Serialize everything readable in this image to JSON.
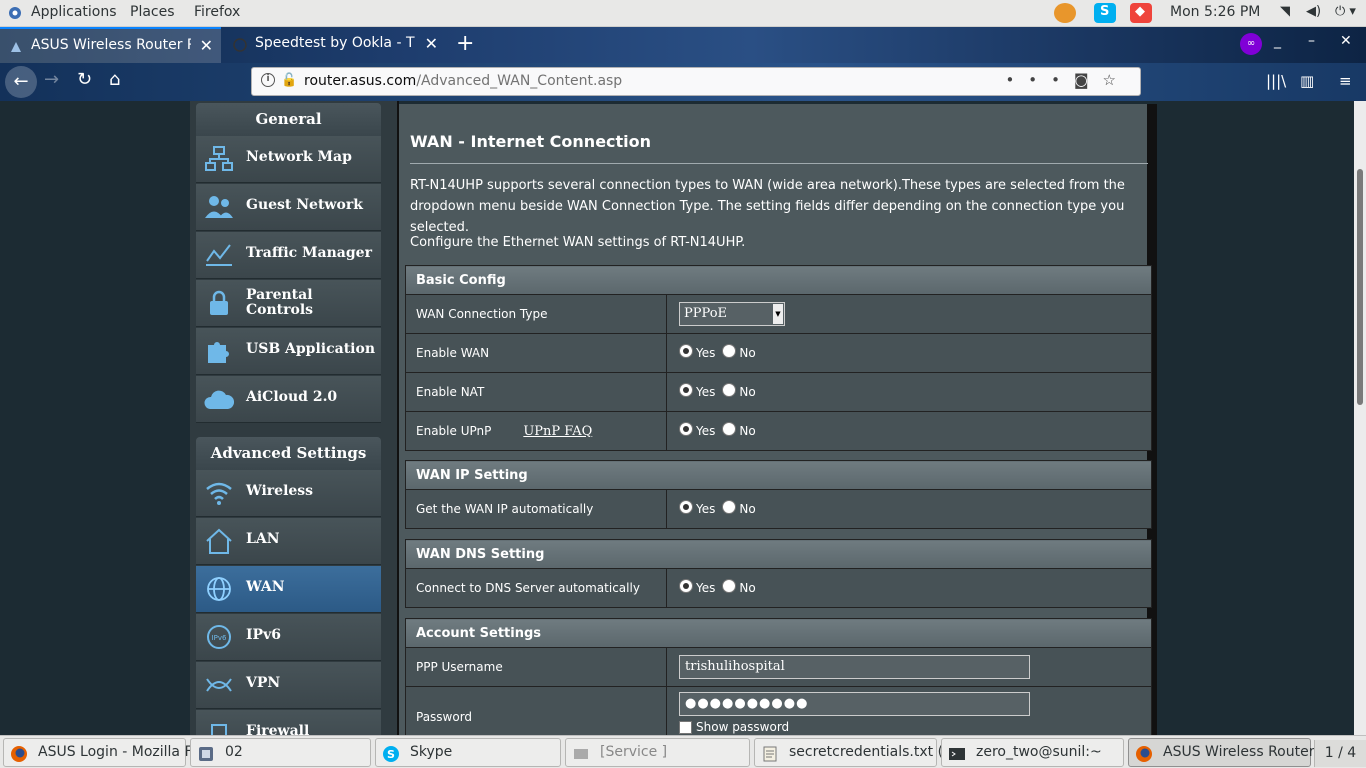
{
  "topbar": {
    "applications": "Applications",
    "places": "Places",
    "firefox": "Firefox",
    "clock": "Mon  5:26 PM",
    "tray_icons": [
      "hexchat-icon",
      "skype-icon",
      "anydesk-icon"
    ]
  },
  "browser": {
    "tabs": [
      {
        "title": "ASUS Wireless Router RT",
        "active": true
      },
      {
        "title": "Speedtest by Ookla - The",
        "active": false
      }
    ],
    "new_tab": "+",
    "url_host": "router.asus.com",
    "url_path": "/Advanced_WAN_Content.asp",
    "url_more": "•••"
  },
  "sidebar": {
    "general_heading": "General",
    "general_items": [
      {
        "label": "Network Map",
        "icon": "network-map-icon"
      },
      {
        "label": "Guest Network",
        "icon": "guest-network-icon"
      },
      {
        "label": "Traffic Manager",
        "icon": "traffic-manager-icon"
      },
      {
        "label": "Parental Controls",
        "icon": "lock-icon"
      },
      {
        "label": "USB Application",
        "icon": "puzzle-icon"
      },
      {
        "label": "AiCloud 2.0",
        "icon": "cloud-icon"
      }
    ],
    "advanced_heading": "Advanced Settings",
    "advanced_items": [
      {
        "label": "Wireless",
        "icon": "wifi-icon"
      },
      {
        "label": "LAN",
        "icon": "house-icon"
      },
      {
        "label": "WAN",
        "icon": "globe-icon",
        "selected": true
      },
      {
        "label": "IPv6",
        "icon": "ipv6-icon"
      },
      {
        "label": "VPN",
        "icon": "vpn-icon"
      },
      {
        "label": "Firewall",
        "icon": "firewall-icon"
      }
    ]
  },
  "content": {
    "title": "WAN - Internet Connection",
    "description": "RT-N14UHP supports several connection types to WAN (wide area network).These types are selected from the dropdown menu beside WAN Connection Type. The setting fields differ depending on the connection type you selected.",
    "configure_text": "Configure the Ethernet WAN settings of RT-N14UHP.",
    "yes": "Yes",
    "no": "No",
    "basic_config": {
      "heading": "Basic Config",
      "wan_type_label": "WAN Connection Type",
      "wan_type_value": "PPPoE",
      "enable_wan_label": "Enable WAN",
      "enable_nat_label": "Enable NAT",
      "enable_upnp_label": "Enable UPnP",
      "upnp_faq": "UPnP FAQ"
    },
    "wan_ip": {
      "heading": "WAN IP Setting",
      "auto_label": "Get the WAN IP automatically"
    },
    "wan_dns": {
      "heading": "WAN DNS Setting",
      "auto_label": "Connect to DNS Server automatically"
    },
    "account": {
      "heading": "Account Settings",
      "username_label": "PPP Username",
      "username_value": "trishulihospital",
      "password_label": "Password",
      "password_value": "●●●●●●●●●●",
      "show_password": "Show password"
    }
  },
  "taskbar": {
    "tasks": [
      {
        "label": "ASUS Login - Mozilla F...",
        "icon": "firefox-icon"
      },
      {
        "label": "02",
        "icon": "file-manager-icon"
      },
      {
        "label": "Skype",
        "icon": "skype-icon"
      },
      {
        "label": "[Service ]",
        "icon": "service-icon"
      },
      {
        "label": "secretcredentials.txt (~...",
        "icon": "text-editor-icon"
      },
      {
        "label": "zero_two@sunil:~",
        "icon": "terminal-icon"
      },
      {
        "label": "ASUS Wireless Router...",
        "icon": "firefox-icon"
      }
    ],
    "workspace": "1 / 4"
  },
  "colors": {
    "page_bg": "#1c2b33",
    "content_bg": "#4d595d",
    "menu_selected": "#2c5a86",
    "accent": "#0a84ff"
  }
}
